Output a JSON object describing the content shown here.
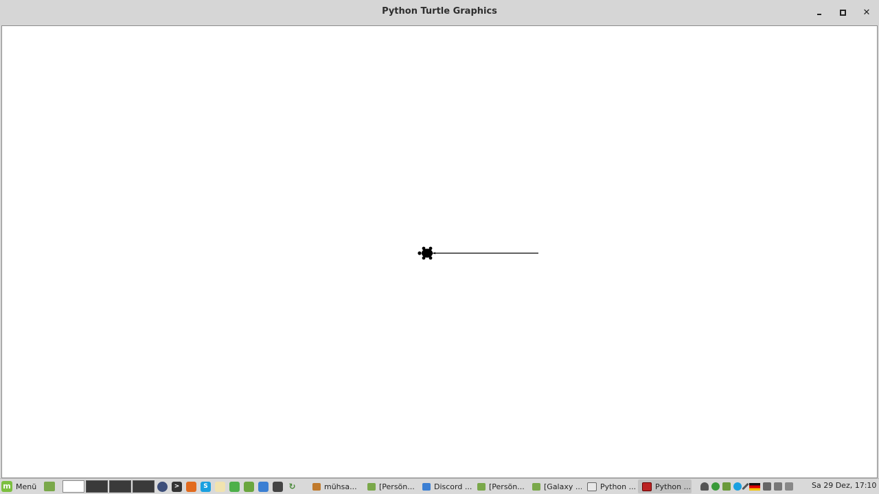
{
  "window": {
    "title": "Python Turtle Graphics",
    "controls": {
      "minimize": "minimize",
      "maximize": "maximize",
      "close": "✕"
    }
  },
  "canvas": {
    "background": "#ffffff",
    "line_color": "#000000",
    "turtle_color": "#000000",
    "turtle_heading": "west"
  },
  "taskbar": {
    "menu_label": "Menü",
    "workspaces": 4,
    "launchers": [
      "workspace-icon",
      "lock-icon",
      "terminal-icon",
      "firefox-icon",
      "skype-icon",
      "text-editor-icon",
      "puzzle-icon",
      "files-icon",
      "chromium-icon",
      "system-monitor-icon",
      "refresh-icon"
    ],
    "tasks": [
      {
        "label": "mühsa...",
        "icon": "gimp-icon",
        "active": false
      },
      {
        "label": "[Persön...",
        "icon": "folder-icon",
        "active": false
      },
      {
        "label": "Discord ...",
        "icon": "chromium-icon",
        "active": false
      },
      {
        "label": "[Persön...",
        "icon": "folder-icon",
        "active": false
      },
      {
        "label": "[Galaxy ...",
        "icon": "folder-icon",
        "active": false
      },
      {
        "label": "Python ...",
        "icon": "editor-icon",
        "active": false
      },
      {
        "label": "Python ...",
        "icon": "tk-window-icon",
        "active": true
      }
    ],
    "tray": [
      "user-icon",
      "chrome-icon",
      "shield-icon",
      "skype-icon",
      "pen-icon",
      "german-flag-icon",
      "clipboard-icon",
      "volume-icon",
      "battery-icon"
    ],
    "clock": "Sa 29 Dez, 17:10"
  }
}
